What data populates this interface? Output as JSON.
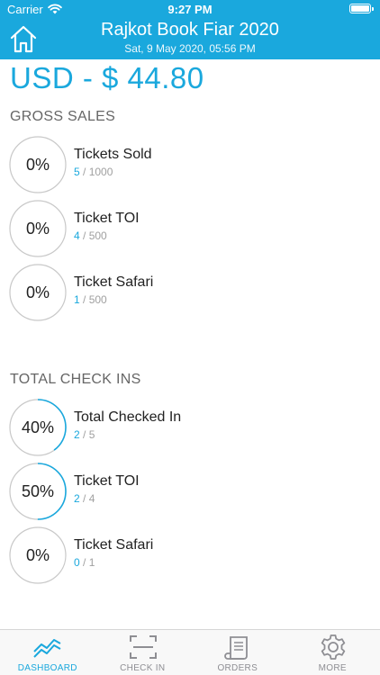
{
  "status_bar": {
    "carrier": "Carrier",
    "time": "9:27 PM"
  },
  "header": {
    "title": "Rajkot Book Fiar 2020",
    "date": "Sat, 9 May 2020, 05:56 PM"
  },
  "total": "USD - $ 44.80",
  "gross_sales": {
    "title": "GROSS SALES",
    "items": [
      {
        "percent_label": "0%",
        "progress": 0.0,
        "name": "Tickets Sold",
        "done": "5",
        "total": " / 1000"
      },
      {
        "percent_label": "0%",
        "progress": 0.0,
        "name": "Ticket TOI",
        "done": "4",
        "total": " / 500"
      },
      {
        "percent_label": "0%",
        "progress": 0.0,
        "name": "Ticket Safari",
        "done": "1",
        "total": " / 500"
      }
    ]
  },
  "check_ins": {
    "title": "TOTAL CHECK INS",
    "items": [
      {
        "percent_label": "40%",
        "progress": 0.4,
        "name": "Total Checked In",
        "done": "2",
        "total": " / 5"
      },
      {
        "percent_label": "50%",
        "progress": 0.5,
        "name": "Ticket TOI",
        "done": "2",
        "total": " / 4"
      },
      {
        "percent_label": "0%",
        "progress": 0.0,
        "name": "Ticket Safari",
        "done": "0",
        "total": " / 1"
      }
    ]
  },
  "tabs": [
    {
      "label": "DASHBOARD",
      "icon": "chart-icon",
      "active": true
    },
    {
      "label": "CHECK IN",
      "icon": "scan-icon",
      "active": false
    },
    {
      "label": "ORDERS",
      "icon": "receipt-icon",
      "active": false
    },
    {
      "label": "MORE",
      "icon": "gear-icon",
      "active": false
    }
  ],
  "colors": {
    "accent": "#1aa8dd",
    "ring_track": "#c8c8c8",
    "tab_inactive": "#8e8e93"
  }
}
